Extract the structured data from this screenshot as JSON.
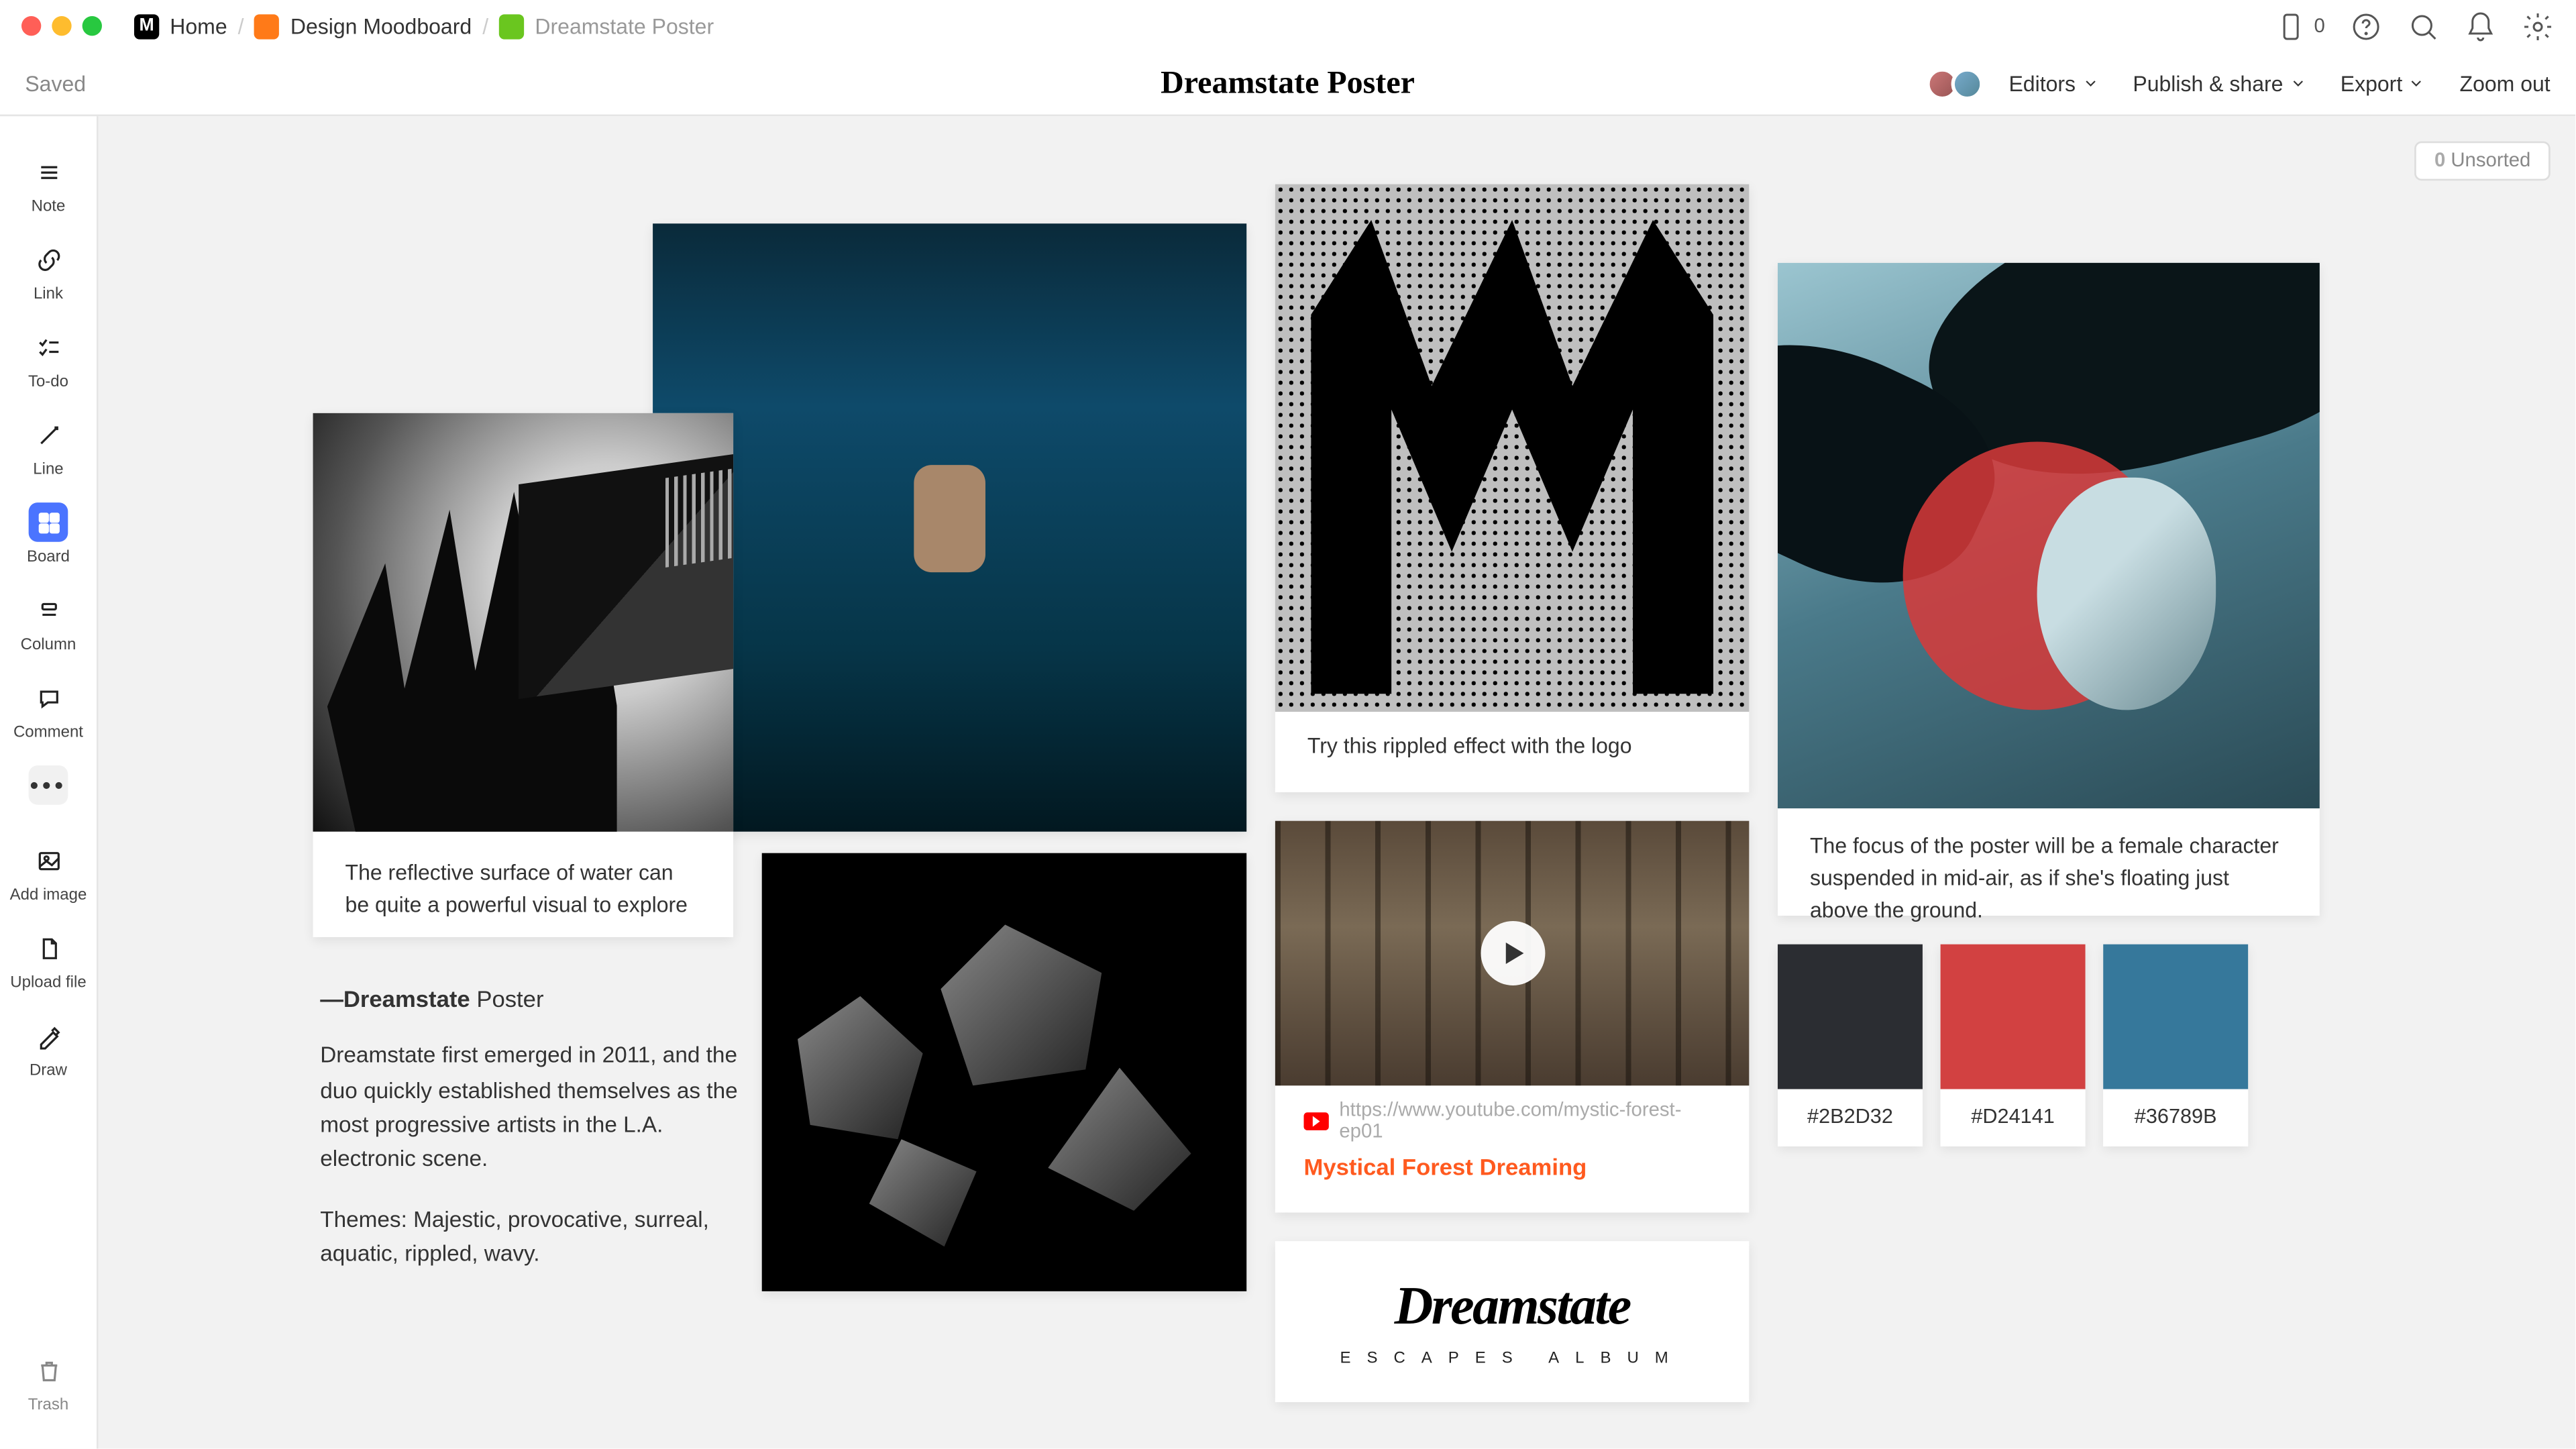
{
  "topbar": {
    "home": "Home",
    "moodboard": "Design Moodboard",
    "current": "Dreamstate Poster",
    "device_count": "0"
  },
  "header": {
    "saved": "Saved",
    "title": "Dreamstate Poster",
    "editors": "Editors",
    "publish": "Publish & share",
    "export": "Export",
    "zoomout": "Zoom out"
  },
  "sidebar": {
    "note": "Note",
    "link": "Link",
    "todo": "To-do",
    "line": "Line",
    "board": "Board",
    "column": "Column",
    "comment": "Comment",
    "addimage": "Add image",
    "uploadfile": "Upload file",
    "draw": "Draw",
    "trash": "Trash"
  },
  "unsorted": {
    "count": "0",
    "label": "Unsorted"
  },
  "cards": {
    "hand_caption": "The reflective surface of water can be quite a powerful visual to explore",
    "m_caption": "Try this rippled effect with the logo",
    "woman_caption": "The focus of the poster will be a female character suspended in mid-air, as if  she's floating just above the ground.",
    "video_url": "https://www.youtube.com/mystic-forest-ep01",
    "video_title": "Mystical Forest Dreaming",
    "logo_main": "Dreamstate",
    "logo_sub": "ESCAPES ALBUM"
  },
  "text": {
    "title_pre": "—Dreamstate",
    "title_post": " Poster",
    "p1": "Dreamstate first emerged in 2011, and the duo quickly established themselves as the most progressive artists in the L.A. electronic scene.",
    "p2": "Themes: Majestic, provocative, surreal, aquatic, rippled, wavy."
  },
  "swatches": {
    "dark": "#2B2D32",
    "red": "#D24141",
    "blue": "#36789B"
  }
}
